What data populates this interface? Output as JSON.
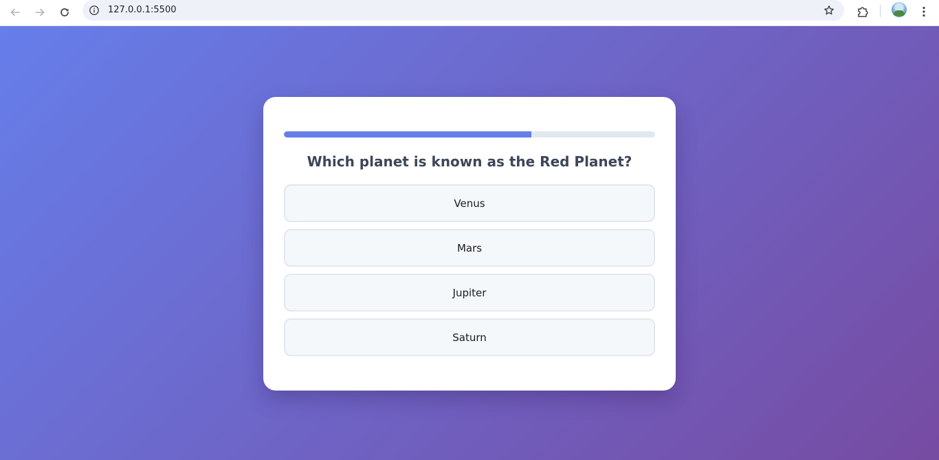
{
  "browser": {
    "url": "127.0.0.1:5500",
    "icons": {
      "back": "back-arrow-icon",
      "forward": "forward-arrow-icon",
      "reload": "reload-icon",
      "site_info": "info-icon",
      "bookmark": "star-icon",
      "extensions": "puzzle-icon",
      "profile": "avatar",
      "menu": "kebab-menu-icon"
    }
  },
  "quiz": {
    "progress_fraction": 0.667,
    "question": "Which planet is known as the Red Planet?",
    "options": [
      "Venus",
      "Mars",
      "Jupiter",
      "Saturn"
    ]
  },
  "colors": {
    "gradient_start": "#667eea",
    "gradient_end": "#764ba2",
    "progress_fill": "#667eea",
    "progress_track": "#e2e8f0",
    "question_text": "#3d4658",
    "option_bg": "#f5f8fb",
    "option_border": "#e2e8f0"
  }
}
